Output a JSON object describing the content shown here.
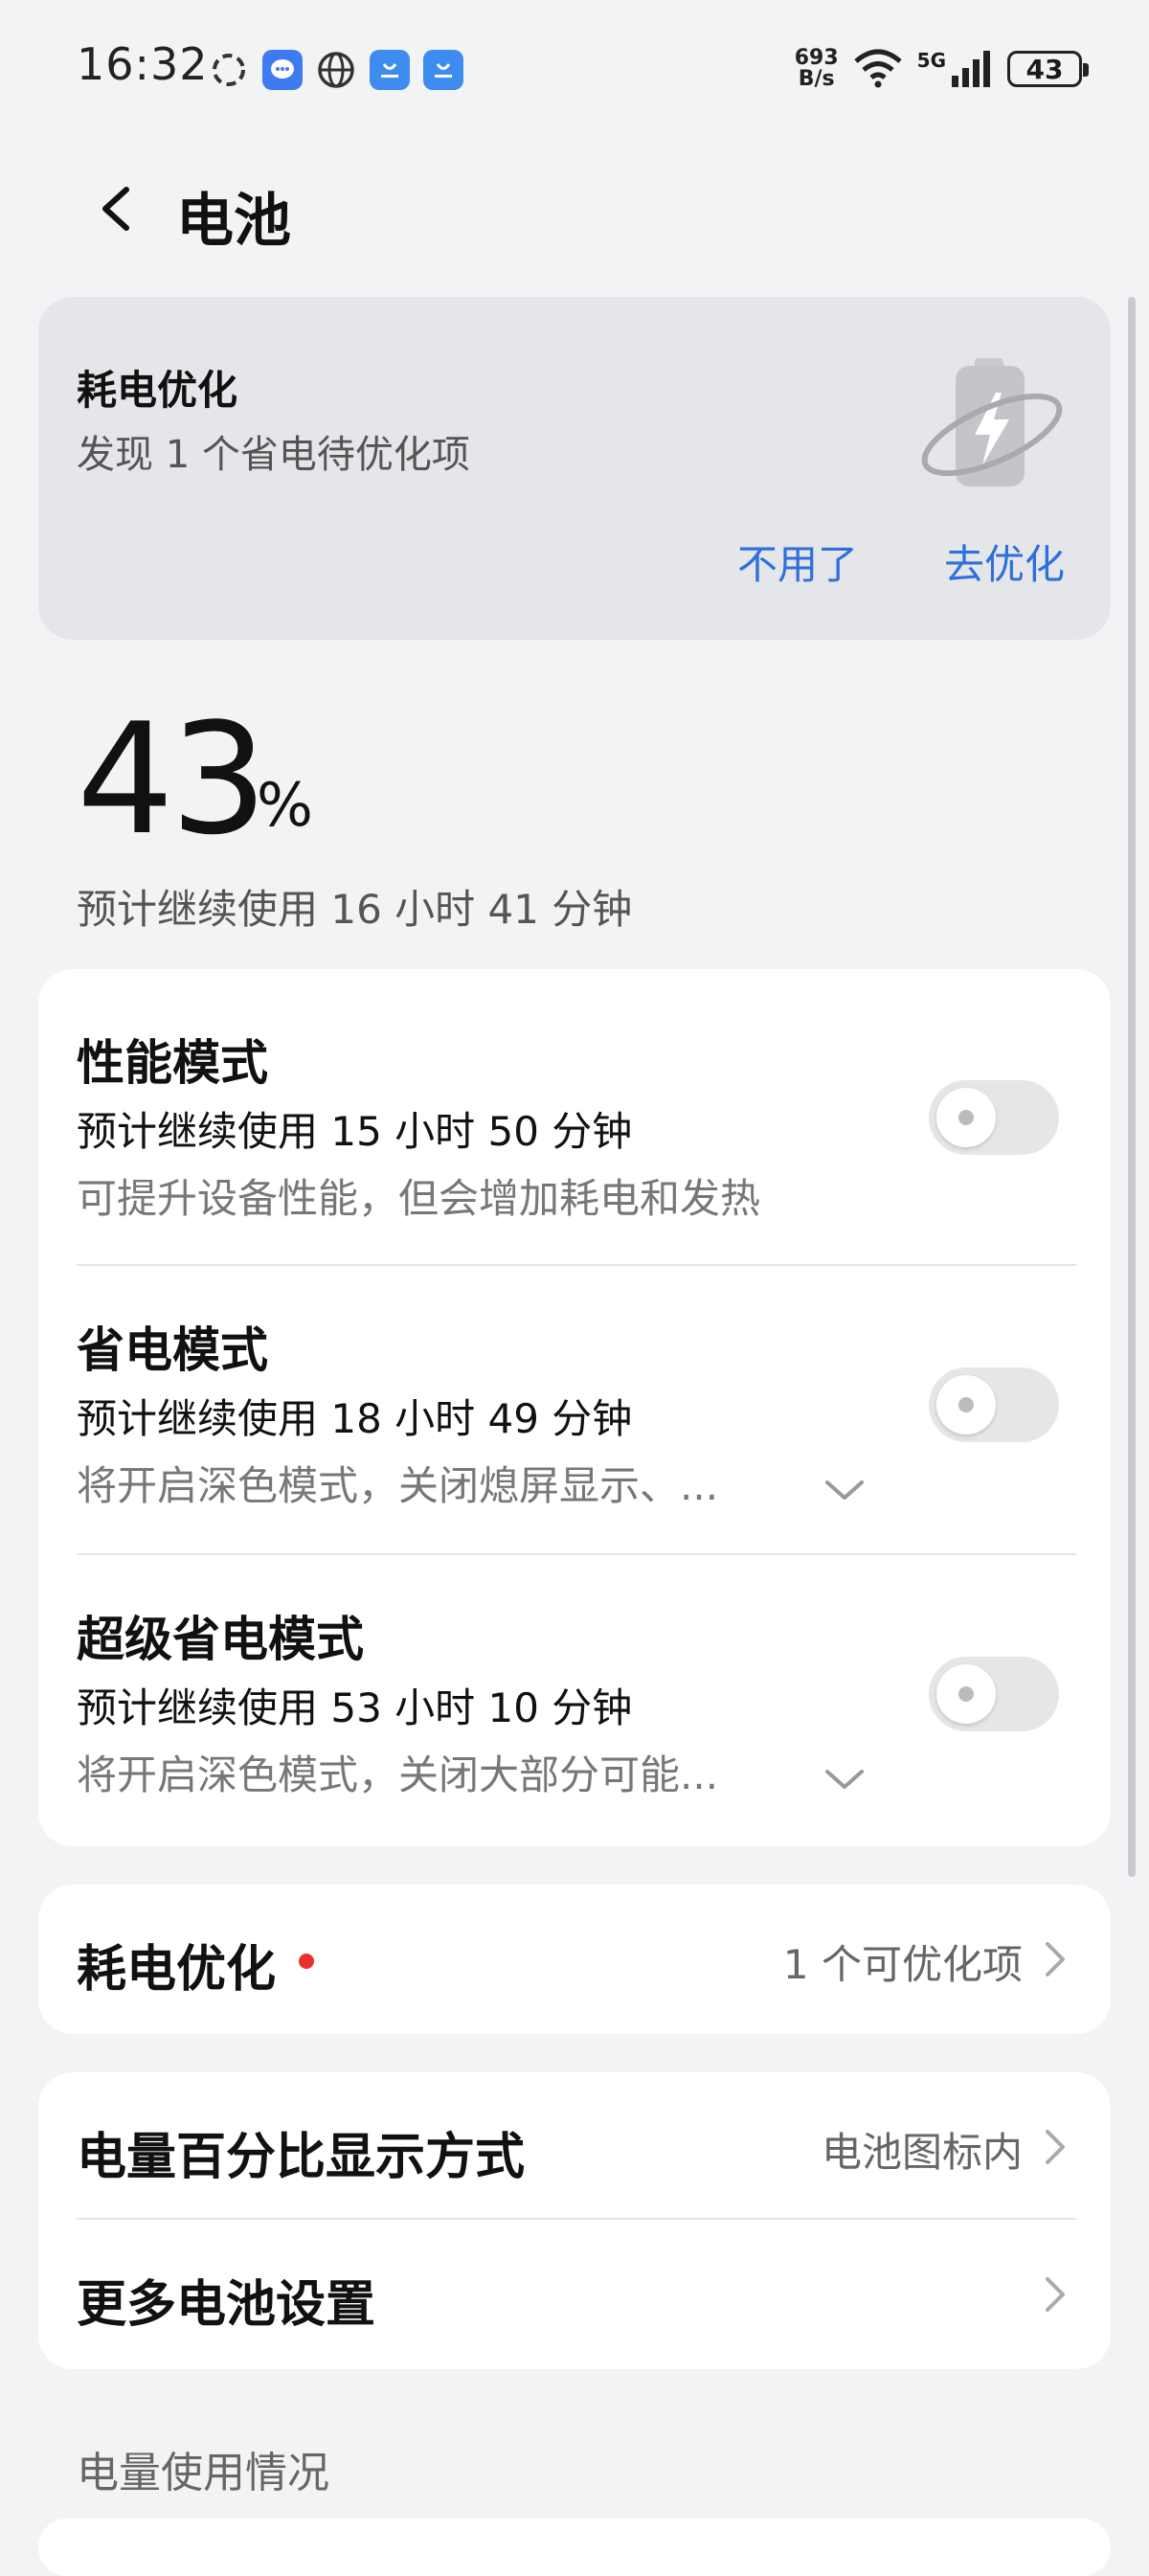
{
  "status_bar": {
    "time": "16:32",
    "net_speed_value": "693",
    "net_speed_unit": "B/s",
    "network_type": "5G",
    "battery_level": "43"
  },
  "header": {
    "title": "电池"
  },
  "optimize_banner": {
    "title": "耗电优化",
    "subtitle": "发现 1 个省电待优化项",
    "dismiss_label": "不用了",
    "optimize_label": "去优化"
  },
  "battery": {
    "percent": "43",
    "percent_symbol": "%",
    "estimate": "预计继续使用 16 小时 41 分钟"
  },
  "modes": [
    {
      "title": "性能模式",
      "estimate": "预计继续使用 15 小时 50 分钟",
      "desc": "可提升设备性能，但会增加耗电和发热",
      "enabled": false
    },
    {
      "title": "省电模式",
      "estimate": "预计继续使用 18 小时 49 分钟",
      "desc": "将开启深色模式，关闭熄屏显示、...",
      "enabled": false
    },
    {
      "title": "超级省电模式",
      "estimate": "预计继续使用 53 小时 10 分钟",
      "desc": "将开启深色模式，关闭大部分可能...",
      "enabled": false
    }
  ],
  "power_optimize_row": {
    "title": "耗电优化",
    "value": "1 个可优化项"
  },
  "settings": [
    {
      "title": "电量百分比显示方式",
      "value": "电池图标内"
    },
    {
      "title": "更多电池设置",
      "value": ""
    }
  ],
  "section_label": "电量使用情况",
  "colors": {
    "accent": "#2F6FDB",
    "alert_dot": "#E8312F",
    "background": "#F1F3F5"
  }
}
